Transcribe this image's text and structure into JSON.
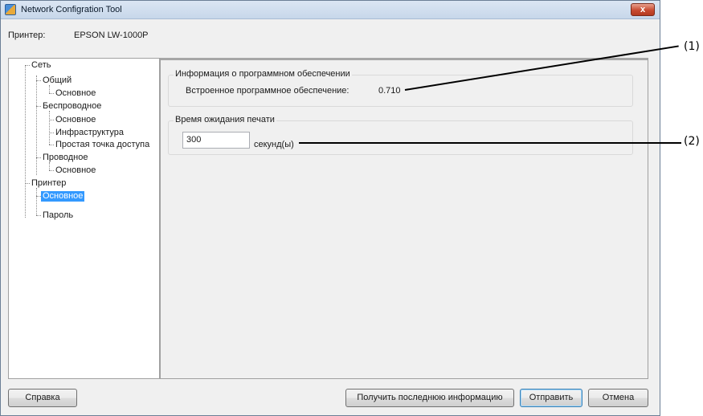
{
  "window": {
    "title": "Network Configration Tool",
    "close_symbol": "x"
  },
  "printer": {
    "label": "Принтер:",
    "value": "EPSON LW-1000P"
  },
  "tree": {
    "items": [
      {
        "label": "Сеть"
      },
      {
        "label": "Общий"
      },
      {
        "label": "Основное"
      },
      {
        "label": "Беспроводное"
      },
      {
        "label": "Основное"
      },
      {
        "label": "Инфраструктура"
      },
      {
        "label": "Простая точка доступа"
      },
      {
        "label": "Проводное"
      },
      {
        "label": "Основное"
      },
      {
        "label": "Принтер"
      },
      {
        "label": "Основное",
        "selected": true
      },
      {
        "label": "Пароль"
      }
    ]
  },
  "firmware_group": {
    "title": "Информация о программном обеспечении",
    "label": "Встроенное программное обеспечение:",
    "value": "0.710"
  },
  "timeout_group": {
    "title": "Время ожидания печати",
    "value": "300",
    "unit": "секунд(ы)"
  },
  "buttons": {
    "help": "Справка",
    "get_latest": "Получить последнюю информацию",
    "send": "Отправить",
    "cancel": "Отмена"
  },
  "callouts": {
    "one": "(1)",
    "two": "(2)"
  },
  "colors": {
    "selection": "#3399ff",
    "titlebar": "#c7d7ea",
    "close": "#c84b31"
  }
}
